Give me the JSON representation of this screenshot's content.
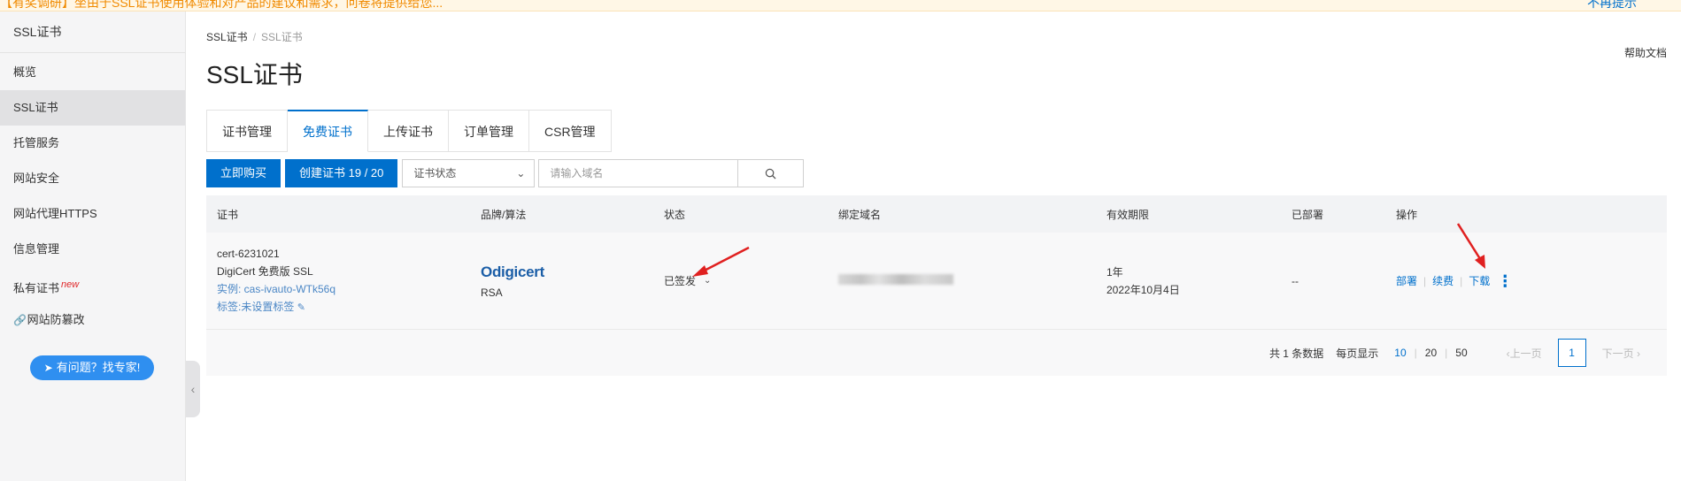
{
  "notice": {
    "left_text": "【有奖调研】坐由于SSL证书使用体验和对产品的建议和需求，问卷将提供给您...",
    "right_text": "不再提示"
  },
  "sidebar": {
    "title": "SSL证书",
    "items": [
      {
        "label": "概览"
      },
      {
        "label": "SSL证书"
      },
      {
        "label": "托管服务"
      },
      {
        "label": "网站安全"
      },
      {
        "label": "网站代理HTTPS"
      },
      {
        "label": "信息管理"
      },
      {
        "label": "私有证书",
        "badge": "new"
      },
      {
        "label": "网站防篡改"
      }
    ],
    "help_button": "有问题？找专家!"
  },
  "breadcrumb": {
    "root": "SSL证书",
    "sep": "/",
    "current": "SSL证书"
  },
  "page_title": "SSL证书",
  "help_doc": "帮助文档",
  "tabs": [
    {
      "label": "证书管理"
    },
    {
      "label": "免费证书"
    },
    {
      "label": "上传证书"
    },
    {
      "label": "订单管理"
    },
    {
      "label": "CSR管理"
    }
  ],
  "toolbar": {
    "buy_button": "立即购买",
    "create_button": "创建证书 19 / 20",
    "status_select": "证书状态",
    "search_placeholder": "请输入域名"
  },
  "table": {
    "headers": [
      "证书",
      "品牌/算法",
      "状态",
      "绑定域名",
      "有效期限",
      "已部署",
      "操作"
    ],
    "row": {
      "cert_id": "cert-6231021",
      "cert_name": "DigiCert 免费版 SSL",
      "instance": "实例: cas-ivauto-WTk56q",
      "tag": "标签:未设置标签",
      "brand": "digicert",
      "algo": "RSA",
      "status": "已签发",
      "validity_term": "1年",
      "validity_date": "2022年10月4日",
      "deployed": "--",
      "ops": [
        "部署",
        "续费",
        "下载"
      ]
    }
  },
  "pager": {
    "total": "共 1 条数据",
    "per_page_label": "每页显示",
    "sizes": [
      "10",
      "20",
      "50"
    ],
    "prev": "上一页",
    "page": "1",
    "next": "下一页"
  },
  "colors": {
    "accent": "#0070cc",
    "arrow": "#e02020",
    "notice_bg": "#fff7e6"
  }
}
